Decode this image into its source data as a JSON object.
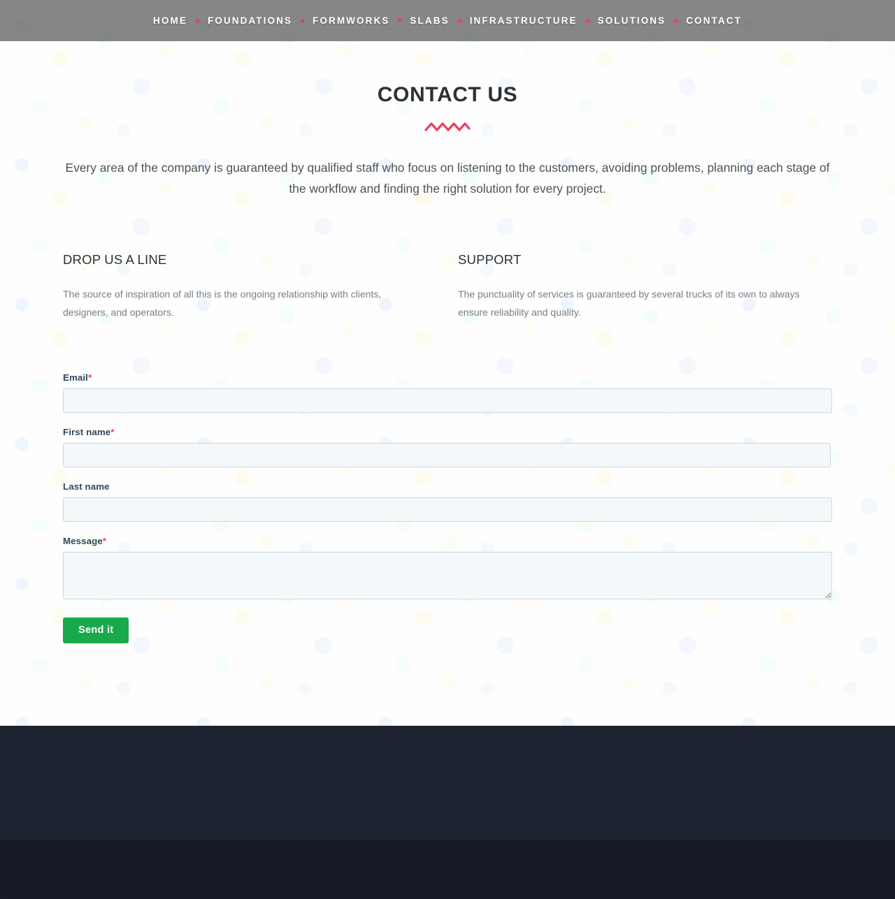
{
  "nav": {
    "items": [
      {
        "label": "HOME"
      },
      {
        "label": "FOUNDATIONS"
      },
      {
        "label": "FORMWORKS"
      },
      {
        "label": "SLABS"
      },
      {
        "label": "INFRASTRUCTURE"
      },
      {
        "label": "SOLUTIONS"
      },
      {
        "label": "CONTACT"
      }
    ],
    "separator_color": "#e8415f",
    "bar_color": "#767676"
  },
  "hero": {
    "title": "CONTACT US",
    "divider_icon": "zigzag-divider-icon",
    "divider_color": "#e8415f",
    "intro": "Every area of the company is guaranteed by qualified staff who focus on listening to the customers, avoiding problems, planning each stage of the workflow and finding the right solution for every project."
  },
  "columns": [
    {
      "title": "DROP US A LINE",
      "body": "The source of inspiration of all this is the ongoing relationship with clients, designers, and operators."
    },
    {
      "title": "SUPPORT",
      "body": "The punctuality of services is guaranteed by several trucks of its own to always ensure reliability and quality."
    }
  ],
  "form": {
    "fields": [
      {
        "label": "Email",
        "required": true,
        "required_mark": "*",
        "value": "",
        "placeholder": ""
      },
      {
        "label": "First name",
        "required": true,
        "required_mark": "*",
        "value": "",
        "placeholder": ""
      },
      {
        "label": "Last name",
        "required": false,
        "required_mark": "",
        "value": "",
        "placeholder": ""
      },
      {
        "label": "Message",
        "required": true,
        "required_mark": "*",
        "value": "",
        "placeholder": ""
      }
    ],
    "submit_label": "Send it",
    "submit_color": "#18a94b"
  },
  "footer": {
    "background_upper": "#1c2230",
    "background_lower": "#161b26"
  }
}
